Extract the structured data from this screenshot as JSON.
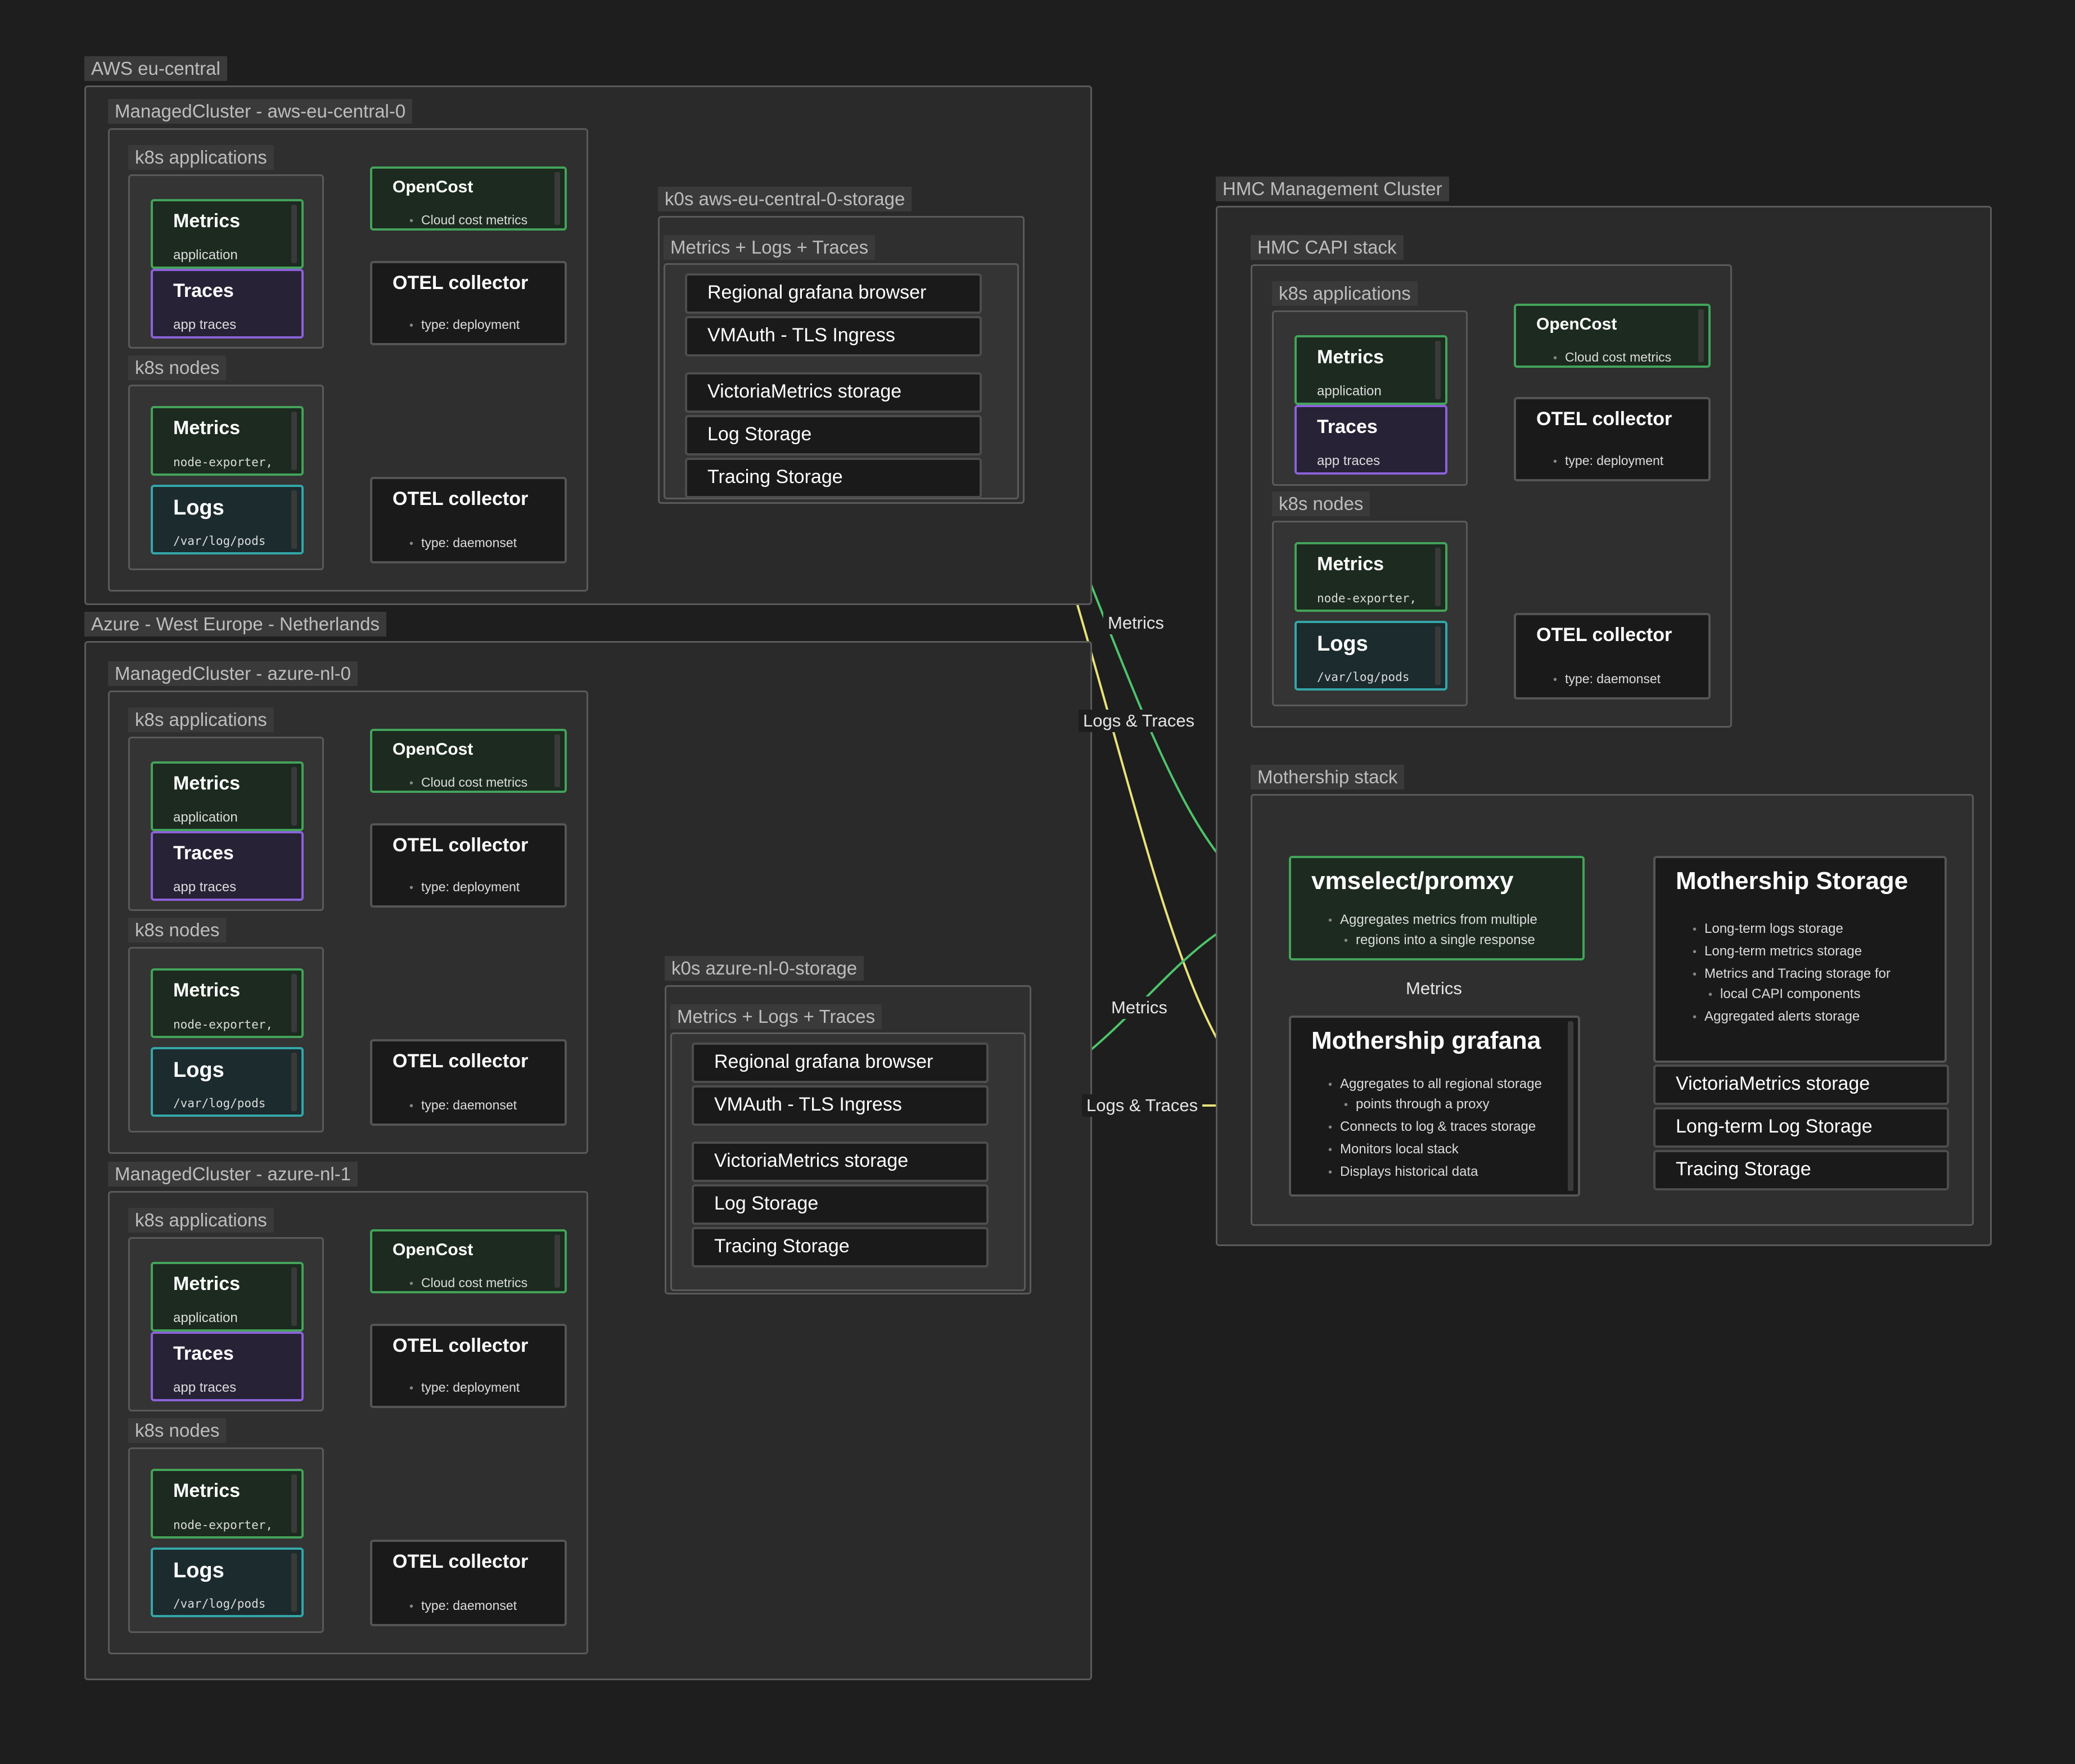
{
  "groups": {
    "aws": "AWS eu-central",
    "aws_mc": "ManagedCluster - aws-eu-central-0",
    "azure": "Azure - West Europe - Netherlands",
    "azure_mc0": "ManagedCluster - azure-nl-0",
    "azure_mc1": "ManagedCluster - azure-nl-1",
    "k8s_apps": "k8s applications",
    "k8s_nodes": "k8s nodes",
    "aws_storage": "k0s aws-eu-central-0-storage",
    "azure_storage": "k0s azure-nl-0-storage",
    "mlt": "Metrics + Logs + Traces",
    "hmc": "HMC Management Cluster",
    "hmc_capi": "HMC CAPI stack",
    "mothership_stack": "Mothership stack"
  },
  "nodes": {
    "metrics": "Metrics",
    "application": "application",
    "traces": "Traces",
    "app_traces": "app traces",
    "node_exporter": "node-exporter,",
    "logs": "Logs",
    "var_log": "/var/log/pods",
    "opencost": "OpenCost",
    "cloud_cost": "Cloud cost metrics",
    "otel": "OTEL collector",
    "type_deployment": "type: deployment",
    "type_daemonset": "type: daemonset"
  },
  "storage_nodes": {
    "grafana_browser": "Regional grafana browser",
    "vmauth": "VMAuth - TLS Ingress",
    "vm_storage": "VictoriaMetrics storage",
    "log_storage": "Log Storage",
    "tracing_storage": "Tracing Storage"
  },
  "mothership": {
    "vmselect_title": "vmselect/promxy",
    "vmselect_b1": "Aggregates metrics from multiple",
    "vmselect_b1b": "regions into a single response",
    "grafana_title": "Mothership grafana",
    "grafana_b1": "Aggregates to all regional storage",
    "grafana_b1b": "points through a proxy",
    "grafana_b2": "Connects to log & traces storage",
    "grafana_b3": "Monitors local stack",
    "grafana_b4": "Displays historical data",
    "storage_title": "Mothership Storage",
    "storage_b1": "Long-term logs storage",
    "storage_b2": "Long-term metrics storage",
    "storage_b3": "Metrics and Tracing storage for",
    "storage_b3b": "local CAPI components",
    "storage_b4": "Aggregated alerts storage",
    "vm_storage": "VictoriaMetrics storage",
    "lt_log_storage": "Long-term Log Storage",
    "tracing_storage": "Tracing Storage"
  },
  "edge_labels": {
    "metrics": "Metrics",
    "logs_traces": "Logs & Traces"
  },
  "colors": {
    "background": "#1e1e1e",
    "metrics_green": "#4ec46b",
    "traces_purple": "#9b6ff0",
    "logs_cyan": "#3cc8d0",
    "grafana_yellow": "#e8e27a",
    "edge_gray": "#8a8a8a"
  }
}
